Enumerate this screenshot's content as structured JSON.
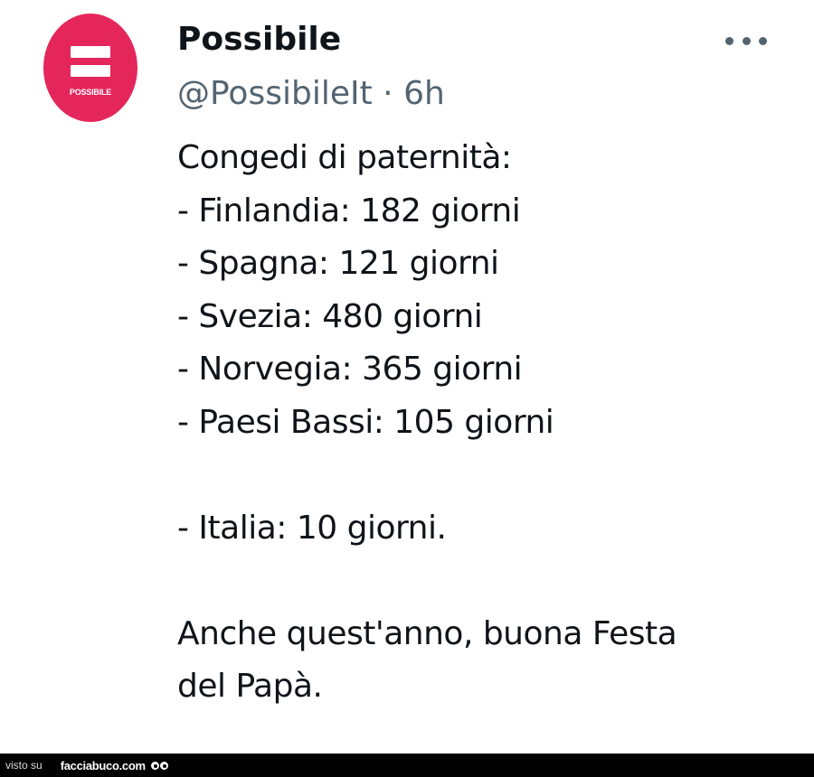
{
  "tweet": {
    "avatar": {
      "logo_text": "POSSIBILE",
      "color": "#e5265b"
    },
    "display_name": "Possibile",
    "handle": "@PossibileIt",
    "separator": "·",
    "time": "6h",
    "menu_icon": "more-horizontal-icon",
    "lines": [
      "Congedi di paternità:",
      "- Finlandia: 182 giorni",
      "- Spagna: 121 giorni",
      "- Svezia: 480 giorni",
      "- Norvegia: 365 giorni",
      "- Paesi Bassi: 105 giorni",
      "",
      "- Italia: 10 giorni.",
      "",
      "Anche quest'anno, buona Festa",
      "del Papà."
    ]
  },
  "footer": {
    "visto_su": "visto su",
    "site": "facciabuco.com"
  }
}
